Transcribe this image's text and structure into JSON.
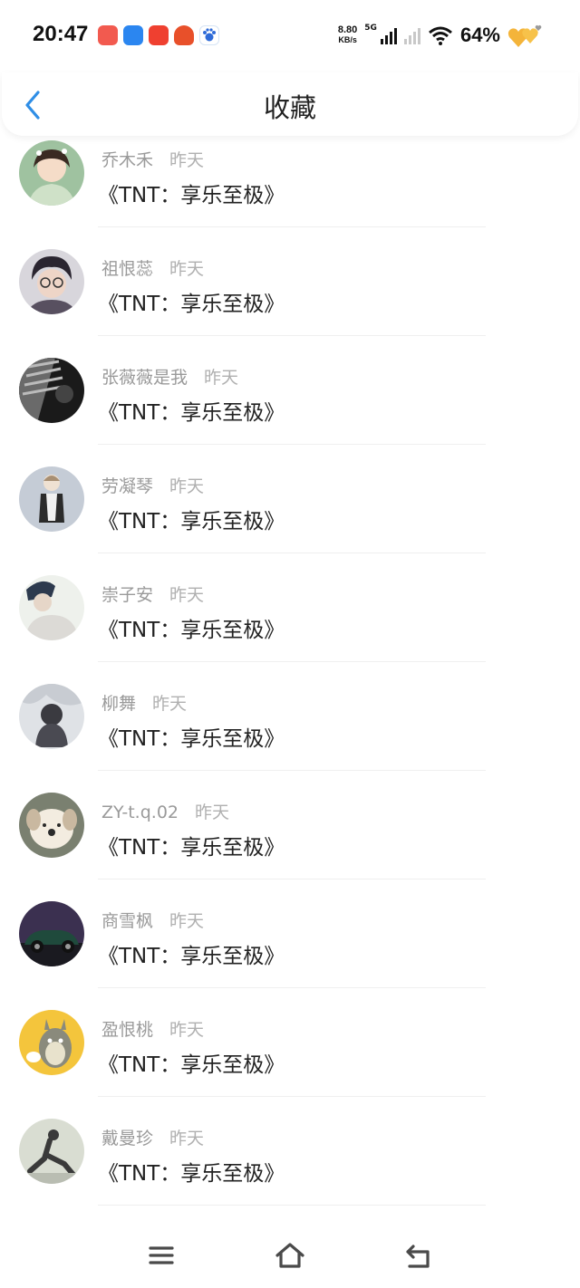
{
  "status": {
    "time": "20:47",
    "net_speed_value": "8.80",
    "net_speed_unit": "KB/s",
    "network_gen": "5G",
    "battery": "64%"
  },
  "header": {
    "title": "收藏"
  },
  "favorites": [
    {
      "name": "乔木禾",
      "time": "昨天",
      "message": "《TNT：享乐至极》"
    },
    {
      "name": "祖恨蕊",
      "time": "昨天",
      "message": "《TNT：享乐至极》"
    },
    {
      "name": "张薇薇是我",
      "time": "昨天",
      "message": "《TNT：享乐至极》"
    },
    {
      "name": "劳凝琴",
      "time": "昨天",
      "message": "《TNT：享乐至极》"
    },
    {
      "name": "崇子安",
      "time": "昨天",
      "message": "《TNT：享乐至极》"
    },
    {
      "name": "柳舞",
      "time": "昨天",
      "message": "《TNT：享乐至极》"
    },
    {
      "name": "ZY-t.q.02",
      "time": "昨天",
      "message": "《TNT：享乐至极》"
    },
    {
      "name": "商雪枫",
      "time": "昨天",
      "message": "《TNT：享乐至极》"
    },
    {
      "name": "盈恨桃",
      "time": "昨天",
      "message": "《TNT：享乐至极》"
    },
    {
      "name": "戴曼珍",
      "time": "昨天",
      "message": "《TNT：享乐至极》"
    }
  ],
  "colors": {
    "accent": "#2f8ee6",
    "name_text": "#9a9a9a",
    "message_text": "#222222"
  }
}
